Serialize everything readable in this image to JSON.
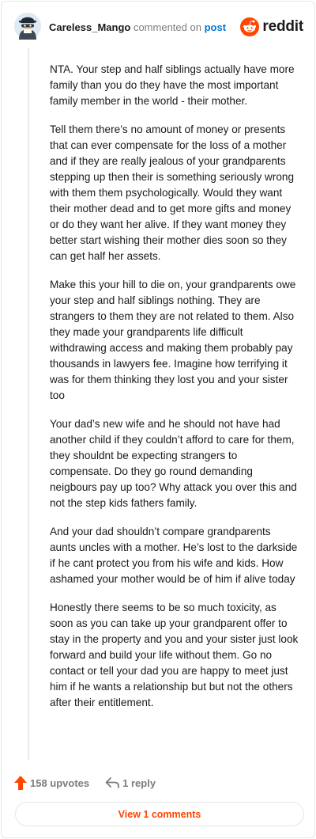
{
  "header": {
    "username": "Careless_Mango",
    "commented_on": "commented on",
    "post_link": "post",
    "brand": "reddit",
    "avatar_icon": "ninja-avatar-icon",
    "brand_icon": "reddit-alien-icon"
  },
  "comment": {
    "paragraphs": [
      "NTA. Your step and half siblings actually have more family than you do they have the most important family member in the world - their mother.",
      "Tell them there’s no amount of money or presents that can ever compensate for the loss of a mother and if they are really jealous of your grandparents stepping up then their is something seriously wrong with them them psychologically. Would they want their mother dead and to get more gifts and money or do they want her alive. If they want money they better start wishing their mother dies soon so they can get half her assets.",
      "Make this your hill to die on, your grandparents owe your step and half siblings nothing. They are strangers to them they are not related to them. Also they made your grandparents life difficult withdrawing access and making them probably pay thousands in lawyers fee. Imagine how terrifying it was for them thinking they lost you and your sister too",
      "Your dad’s new wife and he should not have had another child if they couldn’t afford to care for them, they shouldnt be expecting strangers to compensate. Do they go round demanding neigbours pay up too? Why attack you over this and not the step kids fathers family.",
      "And your dad shouldn’t compare grandparents aunts uncles with a mother. He’s lost to the darkside if he cant protect you from his wife and kids. How ashamed your mother would be of him if alive today",
      "Honestly there seems to be so much toxicity, as soon as you can take up your grandparent offer to stay in the property and you and your sister just look forward and build your life without them. Go no contact or tell your dad you are happy to meet just him if he wants a relationship but but not the others after their entitlement."
    ]
  },
  "actions": {
    "upvotes": "158 upvotes",
    "replies": "1 reply",
    "upvote_icon": "upvote-arrow-icon",
    "reply_icon": "reply-arrow-icon",
    "view_comments": "View 1 comments"
  },
  "colors": {
    "accent": "#ff4500",
    "link": "#0079d3",
    "muted": "#7c7c7c"
  }
}
